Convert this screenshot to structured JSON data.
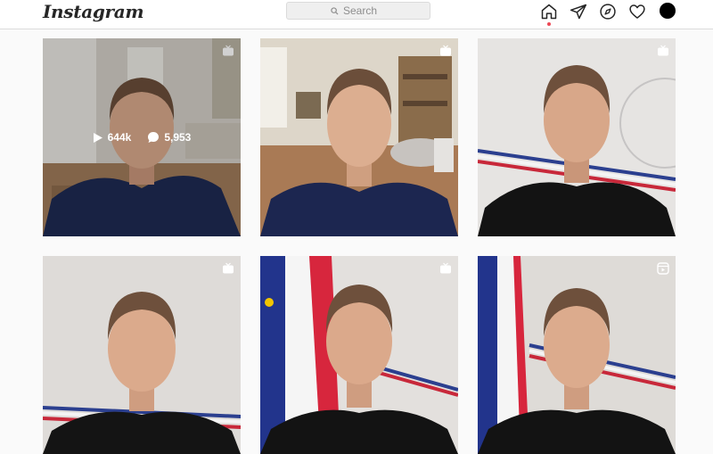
{
  "header": {
    "logo": "Instagram",
    "search": {
      "placeholder": "Search"
    }
  },
  "nav": {
    "icons": [
      "home-icon",
      "direct-messages-icon",
      "explore-icon",
      "activity-heart-icon",
      "profile-avatar"
    ],
    "active": "home",
    "notification_dot_color": "#ed4956"
  },
  "grid": {
    "posts": [
      {
        "type": "igtv",
        "badge_icon": "igtv-icon",
        "hovered": true,
        "views": "644k",
        "comments": "5,953",
        "photo": "man-in-navy-polo-indoor-room-with-window"
      },
      {
        "type": "igtv",
        "badge_icon": "igtv-icon",
        "photo": "man-in-navy-polo-dining-room-with-bookshelf"
      },
      {
        "type": "igtv",
        "badge_icon": "igtv-icon",
        "photo": "man-in-black-tshirt-presidence-seal-wall"
      },
      {
        "type": "igtv",
        "badge_icon": "igtv-icon",
        "photo": "man-in-black-tshirt-plain-wall"
      },
      {
        "type": "igtv",
        "badge_icon": "igtv-icon",
        "photo": "man-in-black-tshirt-with-french-and-eu-flags"
      },
      {
        "type": "reel",
        "badge_icon": "reels-icon",
        "photo": "man-in-black-tshirt-with-french-flag"
      }
    ]
  },
  "colors": {
    "background": "#fafafa",
    "header_bg": "#ffffff",
    "border": "#dbdbdb",
    "text": "#262626",
    "muted": "#8e8e8e"
  }
}
